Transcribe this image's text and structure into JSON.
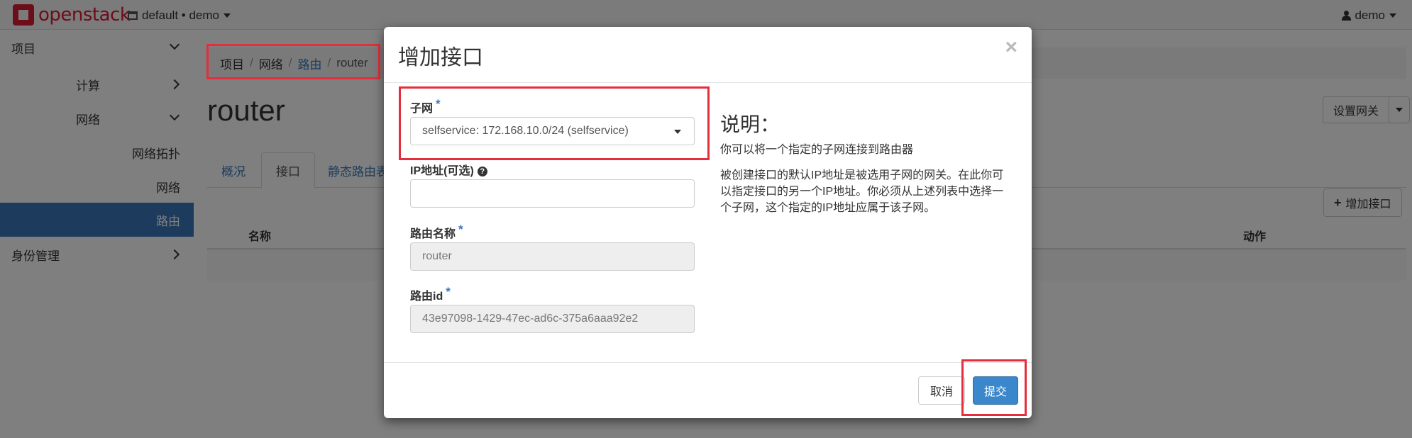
{
  "navbar": {
    "logo_text": "openstack",
    "project": "default • demo",
    "user": "demo"
  },
  "sidebar": {
    "items": [
      {
        "label": "项目"
      },
      {
        "label": "计算"
      },
      {
        "label": "网络"
      },
      {
        "label": "网络拓扑"
      },
      {
        "label": "网络"
      },
      {
        "label": "路由"
      },
      {
        "label": "身份管理"
      }
    ]
  },
  "breadcrumb": {
    "items": [
      "项目",
      "网络",
      "路由",
      "router"
    ],
    "separator": "/"
  },
  "page": {
    "title": "router",
    "gateway_button": "设置网关",
    "tabs": [
      "概况",
      "接口",
      "静态路由表"
    ],
    "add_interface_button": "增加接口",
    "table_columns": [
      "名称",
      "动作"
    ]
  },
  "modal": {
    "title": "增加接口",
    "close_glyph": "×",
    "subnet": {
      "label": "子网",
      "required_mark": "*",
      "value": "selfservice: 172.168.10.0/24 (selfservice)"
    },
    "ip": {
      "label": "IP地址(可选)",
      "help_glyph": "?",
      "value": ""
    },
    "router_name": {
      "label": "路由名称",
      "required_mark": "*",
      "value": "router"
    },
    "router_id": {
      "label": "路由id",
      "required_mark": "*",
      "value": "43e97098-1429-47ec-ad6c-375a6aaa92e2"
    },
    "description": {
      "title": "说明：",
      "line1": "你可以将一个指定的子网连接到路由器",
      "line2": "被创建接口的默认IP地址是被选用子网的网关。在此你可以指定接口的另一个IP地址。你必须从上述列表中选择一个子网，这个指定的IP地址应属于该子网。"
    },
    "cancel_button": "取消",
    "submit_button": "提交"
  },
  "colors": {
    "brand_red": "#da1a32",
    "link_blue": "#3a77b8",
    "primary_button": "#3a87cb",
    "highlight_red": "#e52d3b"
  }
}
